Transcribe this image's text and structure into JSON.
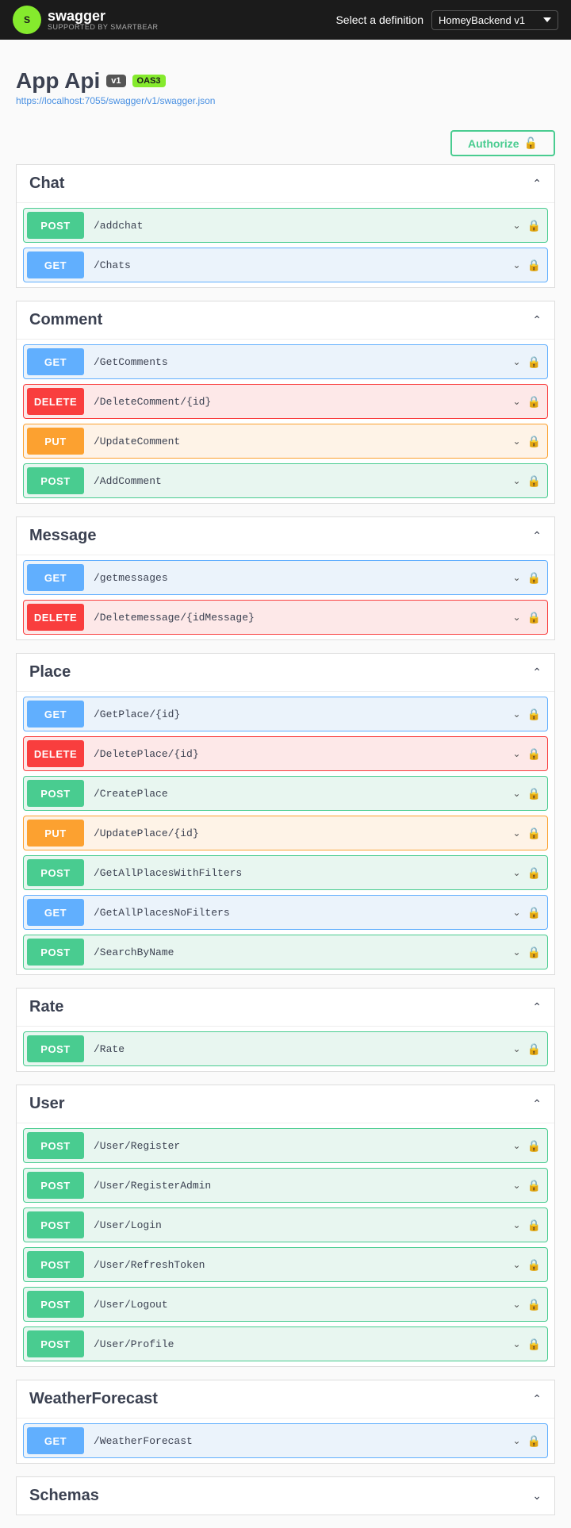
{
  "topbar": {
    "logo_text": "swagger",
    "logo_sub": "SUPPORTED BY SMARTBEAR",
    "logo_initials": "S",
    "select_label": "Select a definition",
    "definition_options": [
      "HomeyBackend v1"
    ],
    "definition_selected": "HomeyBackend v1"
  },
  "api_info": {
    "title": "App Api",
    "badge_v1": "v1",
    "badge_oas3": "OAS3",
    "url": "https://localhost:7055/swagger/v1/swagger.json"
  },
  "authorize_btn": "Authorize",
  "sections": [
    {
      "id": "chat",
      "title": "Chat",
      "endpoints": [
        {
          "method": "POST",
          "path": "/addchat"
        },
        {
          "method": "GET",
          "path": "/Chats"
        }
      ]
    },
    {
      "id": "comment",
      "title": "Comment",
      "endpoints": [
        {
          "method": "GET",
          "path": "/GetComments"
        },
        {
          "method": "DELETE",
          "path": "/DeleteComment/{id}"
        },
        {
          "method": "PUT",
          "path": "/UpdateComment"
        },
        {
          "method": "POST",
          "path": "/AddComment"
        }
      ]
    },
    {
      "id": "message",
      "title": "Message",
      "endpoints": [
        {
          "method": "GET",
          "path": "/getmessages"
        },
        {
          "method": "DELETE",
          "path": "/Deletemessage/{idMessage}"
        }
      ]
    },
    {
      "id": "place",
      "title": "Place",
      "endpoints": [
        {
          "method": "GET",
          "path": "/GetPlace/{id}"
        },
        {
          "method": "DELETE",
          "path": "/DeletePlace/{id}"
        },
        {
          "method": "POST",
          "path": "/CreatePlace"
        },
        {
          "method": "PUT",
          "path": "/UpdatePlace/{id}"
        },
        {
          "method": "POST",
          "path": "/GetAllPlacesWithFilters"
        },
        {
          "method": "GET",
          "path": "/GetAllPlacesNoFilters"
        },
        {
          "method": "POST",
          "path": "/SearchByName"
        }
      ]
    },
    {
      "id": "rate",
      "title": "Rate",
      "endpoints": [
        {
          "method": "POST",
          "path": "/Rate"
        }
      ]
    },
    {
      "id": "user",
      "title": "User",
      "endpoints": [
        {
          "method": "POST",
          "path": "/User/Register"
        },
        {
          "method": "POST",
          "path": "/User/RegisterAdmin"
        },
        {
          "method": "POST",
          "path": "/User/Login"
        },
        {
          "method": "POST",
          "path": "/User/RefreshToken"
        },
        {
          "method": "POST",
          "path": "/User/Logout"
        },
        {
          "method": "POST",
          "path": "/User/Profile"
        }
      ]
    },
    {
      "id": "weatherforecast",
      "title": "WeatherForecast",
      "endpoints": [
        {
          "method": "GET",
          "path": "/WeatherForecast"
        }
      ]
    }
  ],
  "schemas_label": "Schemas",
  "colors": {
    "get": "#61affe",
    "post": "#49cc90",
    "delete": "#f93e3e",
    "put": "#fca130",
    "authorize_border": "#49cc90",
    "authorize_text": "#49cc90"
  }
}
